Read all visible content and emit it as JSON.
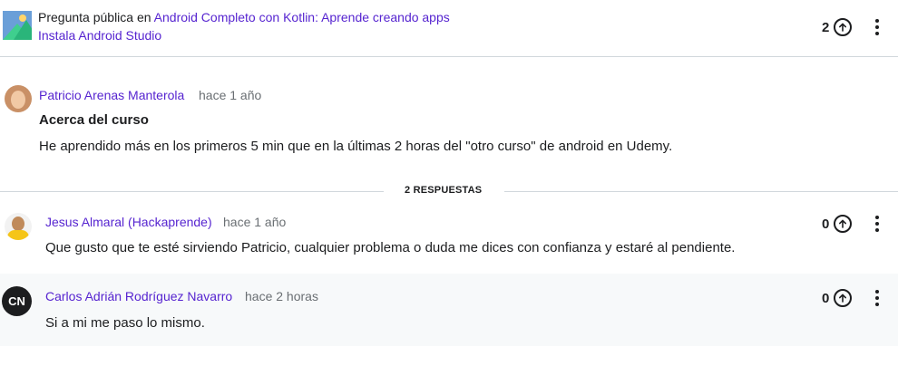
{
  "question": {
    "prefix": "Pregunta pública en ",
    "course_link": "Android Completo con Kotlin: Aprende creando apps",
    "lecture_link": "Instala Android Studio",
    "upvotes": "2",
    "author": "Patricio Arenas Manterola",
    "time": "hace 1 año",
    "title": "Acerca del curso",
    "body": "He aprendido más en los primeros 5 min que en la últimas 2 horas del \"otro curso\" de android en Udemy."
  },
  "replies_label": "2 RESPUESTAS",
  "replies": [
    {
      "author": "Jesus Almaral (Hackaprende)",
      "time": "hace 1 año",
      "upvotes": "0",
      "body": "Que gusto que te esté sirviendo Patricio, cualquier problema o duda me dices con confianza y estaré al pendiente."
    },
    {
      "initials": "CN",
      "author": "Carlos Adrián Rodríguez Navarro",
      "time": "hace 2 horas",
      "upvotes": "0",
      "body": "Si a mi me paso lo mismo."
    }
  ],
  "colors": {
    "link": "#5624d0",
    "text": "#1c1d1f",
    "muted": "#6a6f73",
    "divider": "#d1d7dc",
    "reply_highlight": "#f7f9fa"
  },
  "icons": [
    "course-thumbnail",
    "upvote-arrow-icon",
    "more-options-icon",
    "avatar"
  ]
}
